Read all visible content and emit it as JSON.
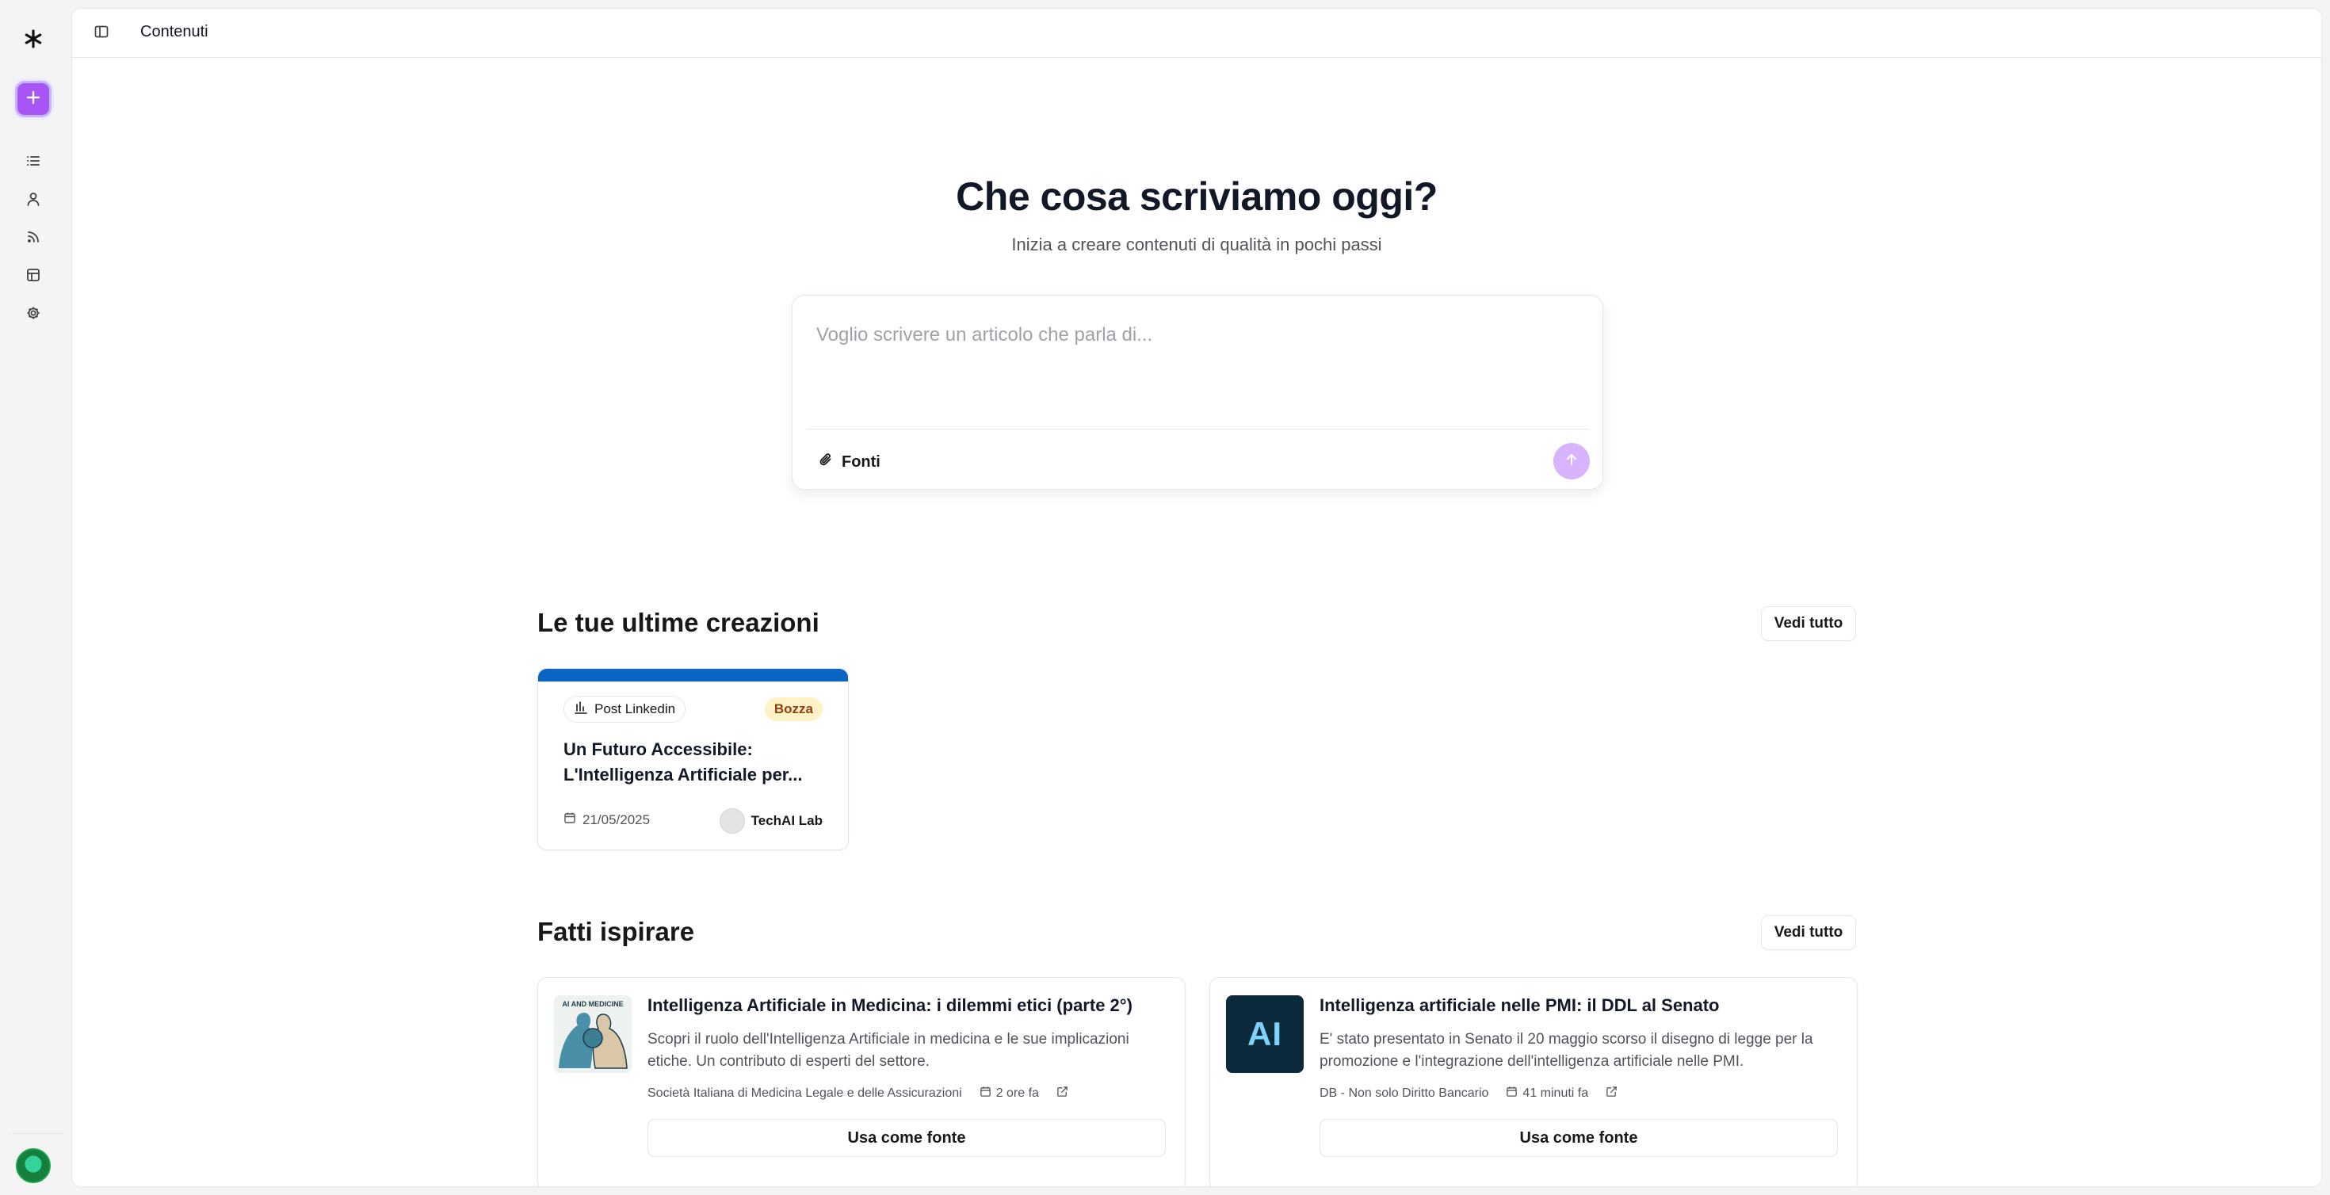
{
  "app": {
    "breadcrumb": "Contenuti",
    "accent_color": "#a855f7",
    "icons": {
      "logo": "asterisk-logo-icon",
      "new": "plus-icon",
      "nav": [
        "list-icon",
        "user-icon",
        "rss-icon",
        "layout-icon",
        "gear-icon"
      ],
      "sidebar_toggle": "panel-left-icon"
    }
  },
  "hero": {
    "title": "Che cosa scriviamo oggi?",
    "subtitle": "Inizia a creare contenuti di qualità in pochi passi"
  },
  "composer": {
    "placeholder": "Voglio scrivere un articolo che parla di...",
    "value": "",
    "sources_label": "Fonti"
  },
  "recent": {
    "title": "Le tue ultime creazioni",
    "see_all": "Vedi tutto",
    "items": [
      {
        "type": "Post Linkedin",
        "status": "Bozza",
        "title": "Un Futuro Accessibile: L'Intelligenza Artificiale per...",
        "date": "21/05/2025",
        "owner": "TechAI Lab",
        "band_color": "#0a66c2"
      }
    ]
  },
  "inspire": {
    "title": "Fatti ispirare",
    "see_all": "Vedi tutto",
    "items": [
      {
        "title": "Intelligenza Artificiale in Medicina: i dilemmi etici (parte 2°)",
        "description": "Scopri il ruolo dell'Intelligenza Artificiale in medicina e le sue implicazioni etiche. Un contributo di esperti del settore.",
        "source": "Società Italiana di Medicina Legale e delle Assicurazioni",
        "time": "2 ore fa",
        "thumb_text": "AI AND MEDICINE",
        "action": "Usa come fonte"
      },
      {
        "title": "Intelligenza artificiale nelle PMI: il DDL al Senato",
        "description": "E' stato presentato in Senato il 20 maggio scorso il disegno di legge per la promozione e l'integrazione dell'intelligenza artificiale nelle PMI.",
        "source": "DB - Non solo Diritto Bancario",
        "time": "41 minuti fa",
        "thumb_text": "AI",
        "action": "Usa come fonte"
      }
    ]
  }
}
